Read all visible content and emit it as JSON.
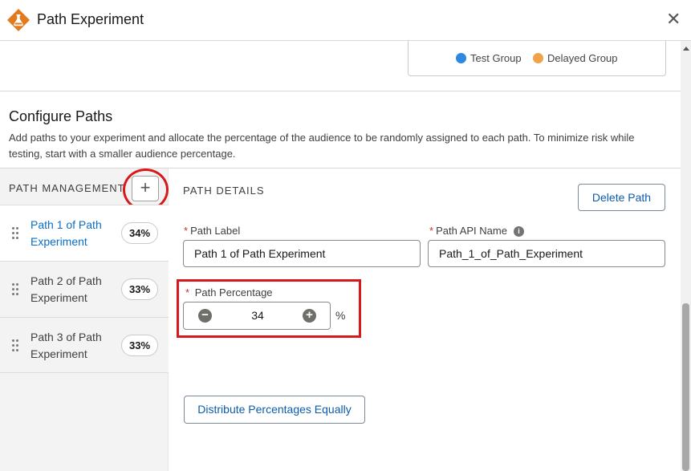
{
  "header": {
    "title": "Path Experiment",
    "close_icon": "close-icon"
  },
  "legend": {
    "items": [
      {
        "label": "Test Group",
        "color": "#2e88e0"
      },
      {
        "label": "Delayed Group",
        "color": "#f0a24a"
      }
    ]
  },
  "configure": {
    "title": "Configure Paths",
    "description": "Add paths to your experiment and allocate the percentage of the audience to be randomly assigned to each path. To minimize risk while testing, start with a smaller audience percentage."
  },
  "path_management": {
    "label": "PATH MANAGEMENT",
    "add_button": "+",
    "items": [
      {
        "name": "Path 1 of Path Experiment",
        "percent": "34%",
        "active": true
      },
      {
        "name": "Path 2 of Path Experiment",
        "percent": "33%",
        "active": false
      },
      {
        "name": "Path 3 of Path Experiment",
        "percent": "33%",
        "active": false
      }
    ]
  },
  "path_details": {
    "label": "PATH DETAILS",
    "delete_button": "Delete Path",
    "path_label": {
      "label": "Path Label",
      "value": "Path 1 of Path Experiment",
      "required": "*"
    },
    "api_name": {
      "label": "Path API Name",
      "value": "Path_1_of_Path_Experiment",
      "required": "*"
    },
    "percentage": {
      "label": "Path Percentage",
      "value": "34",
      "unit": "%",
      "required": "*",
      "minus": "−",
      "plus": "+"
    },
    "distribute_button": "Distribute Percentages Equally"
  }
}
